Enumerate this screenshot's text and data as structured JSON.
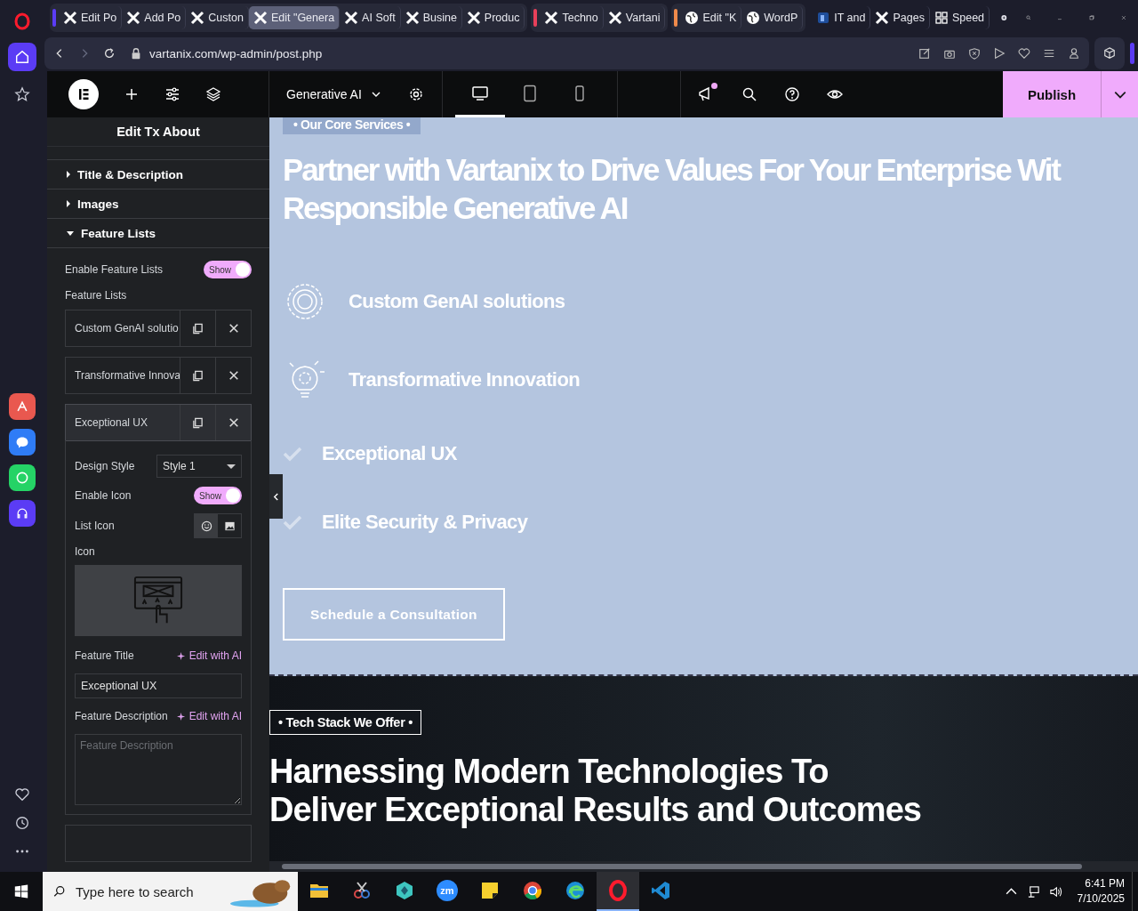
{
  "browser": {
    "tab_groups": [
      {
        "color": "#5b3cf5",
        "tabs": [
          {
            "title": "Edit Po",
            "kind": "x",
            "selected": false
          },
          {
            "title": "Add Po",
            "kind": "x",
            "selected": false
          },
          {
            "title": "Custon",
            "kind": "x",
            "selected": false
          },
          {
            "title": "Edit \"Genera",
            "kind": "x",
            "selected": true
          },
          {
            "title": "AI Soft",
            "kind": "x",
            "selected": false
          },
          {
            "title": "Busine",
            "kind": "x",
            "selected": false
          },
          {
            "title": "Produc",
            "kind": "x",
            "selected": false
          }
        ]
      },
      {
        "color": "#e8405a",
        "tabs": [
          {
            "title": "Techno",
            "kind": "x",
            "selected": false
          },
          {
            "title": "Vartani",
            "kind": "x",
            "selected": false
          }
        ]
      },
      {
        "color": "#f08a4b",
        "tabs": [
          {
            "title": "Edit \"K",
            "kind": "globe",
            "selected": false
          },
          {
            "title": "WordP",
            "kind": "globe",
            "selected": false
          }
        ]
      },
      {
        "tabs": [
          {
            "title": "IT and",
            "kind": "doc",
            "selected": false
          },
          {
            "title": "Pages",
            "kind": "x",
            "selected": false
          },
          {
            "title": "Speed",
            "kind": "grid",
            "selected": false
          }
        ]
      }
    ],
    "address": "vartanix.com/wp-admin/post.php",
    "sidebar": [
      {
        "kind": "home",
        "selected": true
      },
      {
        "kind": "star",
        "selected": false
      }
    ],
    "sidebar_apps": [
      {
        "kind": "a",
        "color": "#e9584f"
      },
      {
        "kind": "chat",
        "color": "#2f7cf6"
      },
      {
        "kind": "phone",
        "color": "#25d366"
      },
      {
        "kind": "headset",
        "color": "#5b3cf5"
      }
    ]
  },
  "editor": {
    "page_title": "Generative AI",
    "has_updates": true,
    "devices": [
      {
        "kind": "desktop",
        "selected": true
      },
      {
        "kind": "tablet",
        "selected": false
      },
      {
        "kind": "mobile",
        "selected": false
      }
    ],
    "publish": "Publish"
  },
  "panel": {
    "title": "Edit Tx About",
    "sections": [
      {
        "label": "Title & Description",
        "expanded": false
      },
      {
        "label": "Images",
        "expanded": false
      },
      {
        "label": "Feature Lists",
        "expanded": true
      }
    ],
    "enable_feature_lists": {
      "label": "Enable Feature Lists",
      "toggle": "Show",
      "on": true
    },
    "repeater_label": "Feature Lists",
    "items": [
      {
        "title": "Custom GenAI solutio",
        "expanded": false
      },
      {
        "title": "Transformative Innova",
        "expanded": false
      },
      {
        "title": "Exceptional UX",
        "expanded": true
      }
    ],
    "item_fields": {
      "design_style": {
        "label": "Design Style",
        "value": "Style 1"
      },
      "enable_icon": {
        "label": "Enable Icon",
        "toggle": "Show",
        "on": true
      },
      "list_icon": {
        "label": "List Icon",
        "options": [
          {
            "kind": "icon",
            "selected": true
          },
          {
            "kind": "image",
            "selected": false
          }
        ]
      },
      "icon_label": "Icon",
      "feature_title": {
        "label": "Feature Title",
        "ai": "Edit with AI",
        "value": "Exceptional UX"
      },
      "feature_description": {
        "label": "Feature Description",
        "ai": "Edit with AI",
        "placeholder": "Feature Description"
      }
    }
  },
  "canvas": {
    "eyebrow": "• Our Core Services •",
    "heading": [
      "Partner with Vartanix to Drive Values For Your Enterprise Wit",
      "Responsible Generative AI"
    ],
    "features": [
      {
        "kind": "ai-gear",
        "title": "Custom GenAI solutions"
      },
      {
        "kind": "bulb",
        "title": "Transformative Innovation"
      },
      {
        "kind": "check",
        "title": "Exceptional UX"
      },
      {
        "kind": "check",
        "title": "Elite Security & Privacy"
      }
    ],
    "cta": "Schedule a Consultation",
    "dark_section": {
      "eyebrow": "• Tech Stack We Offer •",
      "heading": [
        "Harnessing Modern Technologies To",
        "Deliver Exceptional Results and Outcomes"
      ]
    }
  },
  "taskbar": {
    "search_placeholder": "Type here to search",
    "apps": [
      {
        "kind": "folder",
        "selected": false
      },
      {
        "kind": "snip",
        "selected": false
      },
      {
        "kind": "cube",
        "selected": false
      },
      {
        "kind": "zoom",
        "label": "zm",
        "selected": false
      },
      {
        "kind": "note",
        "selected": false
      },
      {
        "kind": "chrome",
        "selected": false
      },
      {
        "kind": "edge",
        "selected": false
      },
      {
        "kind": "opera",
        "selected": true
      },
      {
        "kind": "code",
        "selected": false
      }
    ],
    "time": "6:41 PM",
    "date": "7/10/2025"
  }
}
